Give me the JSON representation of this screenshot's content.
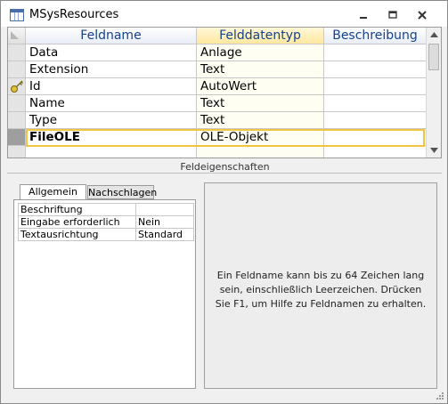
{
  "window": {
    "title": "MSysResources"
  },
  "grid": {
    "columns": [
      "Feldname",
      "Felddatentyp",
      "Beschreibung"
    ],
    "rows": [
      {
        "name": "Data",
        "type": "Anlage",
        "desc": ""
      },
      {
        "name": "Extension",
        "type": "Text",
        "desc": ""
      },
      {
        "name": "Id",
        "type": "AutoWert",
        "desc": "",
        "primary_key": true
      },
      {
        "name": "Name",
        "type": "Text",
        "desc": ""
      },
      {
        "name": "Type",
        "type": "Text",
        "desc": ""
      },
      {
        "name": "FileOLE",
        "type": "OLE-Objekt",
        "desc": "",
        "active": true
      }
    ]
  },
  "section_label": "Feldeigenschaften",
  "tabs": [
    "Allgemein",
    "Nachschlagen"
  ],
  "properties": [
    {
      "name": "Beschriftung",
      "value": ""
    },
    {
      "name": "Eingabe erforderlich",
      "value": "Nein"
    },
    {
      "name": "Textausrichtung",
      "value": "Standard"
    }
  ],
  "help_text": "Ein Feldname kann bis zu 64 Zeichen lang sein, einschließlich Leerzeichen. Drücken Sie F1, um Hilfe zu Feldnamen zu erhalten.",
  "colors": {
    "header_text": "#15428b",
    "selection_border": "#f2c440",
    "active_row_selector": "#9e9e9e"
  },
  "icons": {
    "app": "table-icon",
    "minimize": "minimize-icon",
    "restore": "restore-icon",
    "close": "close-icon",
    "primary_key": "key-icon"
  }
}
